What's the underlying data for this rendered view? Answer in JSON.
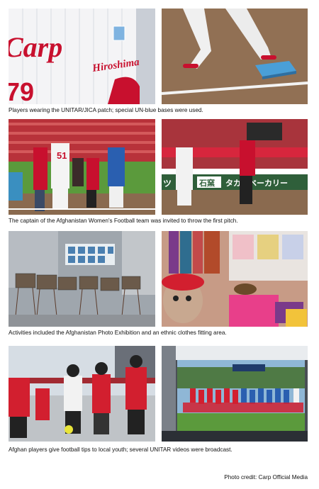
{
  "captions": [
    "Players wearing the UNITAR/JICA patch;  special UN-blue bases were used.",
    "The captain of the Afghanistan Women's Football team was invited to throw the first pitch.",
    "Activities included the Afghanistan Photo Exhibition and an ethnic clothes fitting area.",
    "Afghan players give football tips to local youth; several UNITAR videos were broadcast."
  ],
  "photo_text": {
    "jersey_script": "Carp",
    "jersey_number": "79",
    "sleeve_script": "Hiroshima",
    "player_number": "51",
    "sign_left": "ツ",
    "sign_box": "石窯",
    "sign_right": "タカキベーカリー"
  },
  "credit": "Photo credit: Carp Official Media",
  "colors": {
    "carp_red": "#d7263d",
    "un_blue": "#4a9fd8",
    "field_brown": "#8a6a4f",
    "grass": "#5b9a3c"
  }
}
